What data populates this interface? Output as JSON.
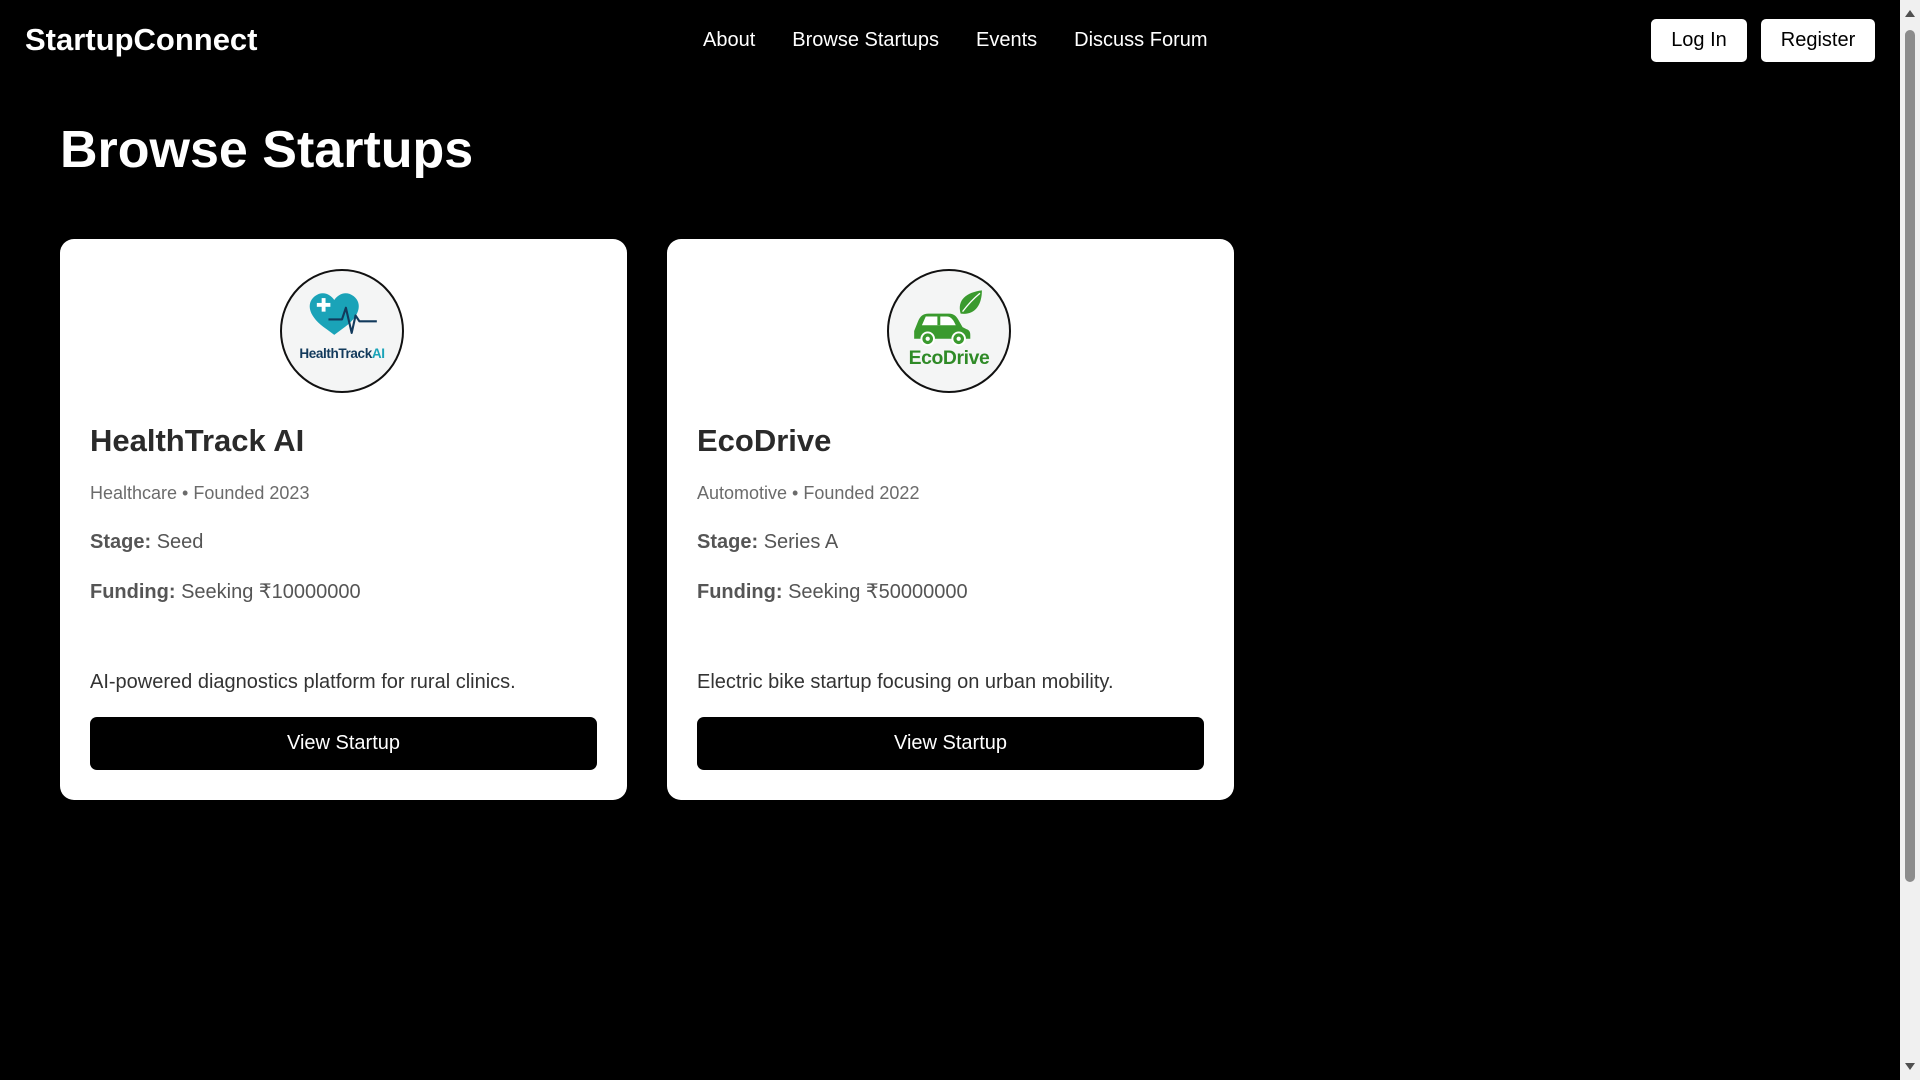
{
  "brand": "StartupConnect",
  "nav": {
    "links": [
      "About",
      "Browse Startups",
      "Events",
      "Discuss Forum"
    ]
  },
  "auth": {
    "login_label": "Log In",
    "register_label": "Register"
  },
  "page_title": "Browse Startups",
  "startups": [
    {
      "logo_icon": "heart-pulse-icon",
      "logo_text_a": "HealthTrack",
      "logo_text_b": "AI",
      "name": "HealthTrack AI",
      "meta": "Healthcare • Founded 2023",
      "stage_label": "Stage:",
      "stage": "Seed",
      "funding_label": "Funding:",
      "funding": "Seeking ₹10000000",
      "description": "AI-powered diagnostics platform for rural clinics.",
      "button_label": "View Startup"
    },
    {
      "logo_icon": "green-car-leaf-icon",
      "logo_text": "EcoDrive",
      "name": "EcoDrive",
      "meta": "Automotive • Founded 2022",
      "stage_label": "Stage:",
      "stage": "Series A",
      "funding_label": "Funding:",
      "funding": "Seeking ₹50000000",
      "description": "Electric bike startup focusing on urban mobility.",
      "button_label": "View Startup"
    }
  ],
  "colors": {
    "background": "#000000",
    "card": "#ffffff",
    "button": "#000000",
    "health_teal": "#1aa3b8",
    "health_navy": "#123a5c",
    "eco_green": "#3a9a2e"
  }
}
